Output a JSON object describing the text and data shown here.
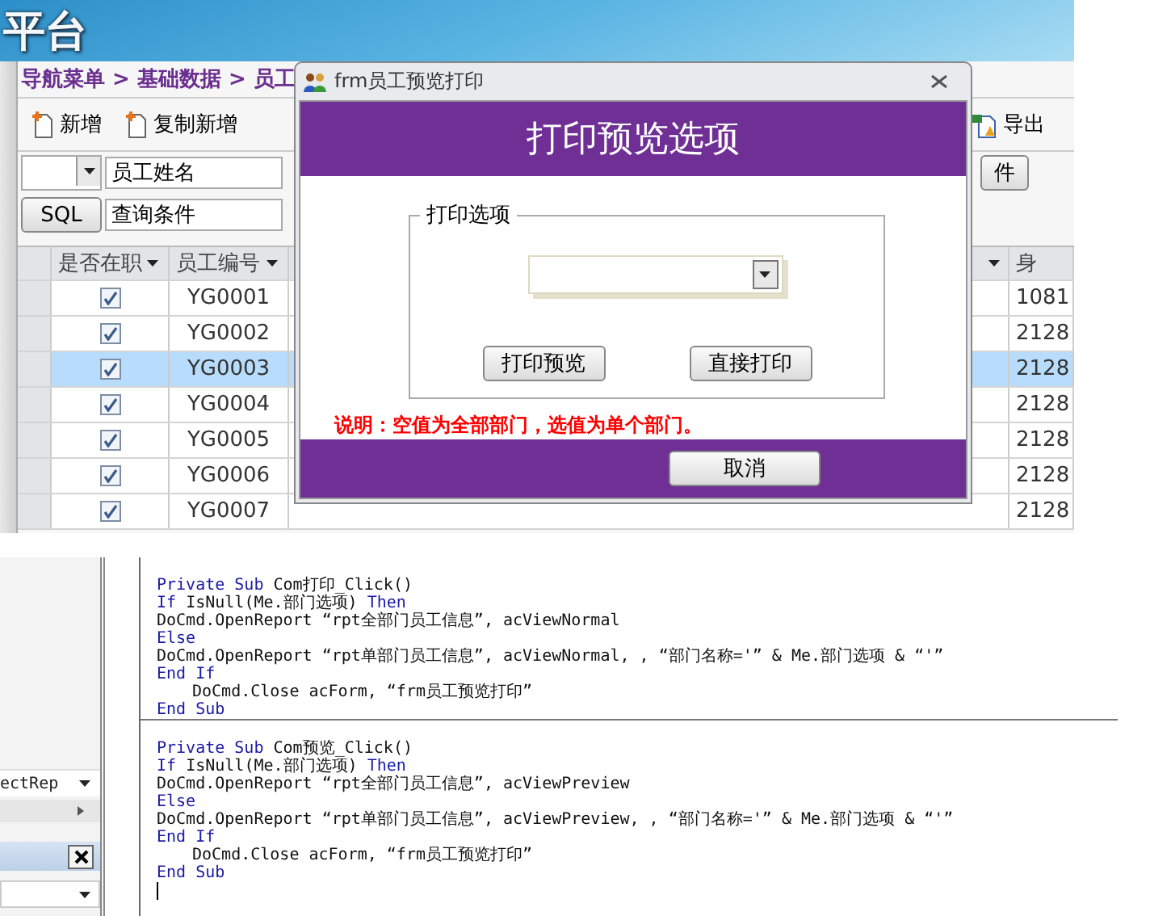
{
  "banner": {
    "title": "平台"
  },
  "breadcrumb": "导航菜单 > 基础数据 > 员工",
  "toolbar": [
    {
      "label": "新增",
      "kind": "new"
    },
    {
      "label": "复制新增",
      "kind": "new"
    },
    {
      "label": "导出",
      "kind": "export"
    }
  ],
  "search": {
    "value": "员工姓名",
    "button": "件"
  },
  "query": {
    "button": "SQL",
    "value": "查询条件"
  },
  "table": {
    "columns": [
      "是否在职",
      "员工编号"
    ],
    "last_column": "身",
    "rows": [
      {
        "active": true,
        "code": "YG0001",
        "column_9": "1081",
        "selected": false
      },
      {
        "active": true,
        "code": "YG0002",
        "column_9": "2128",
        "selected": false
      },
      {
        "active": true,
        "code": "YG0003",
        "column_9": "2128",
        "selected": true
      },
      {
        "active": true,
        "code": "YG0004",
        "column_9": "2128",
        "selected": false
      },
      {
        "active": true,
        "code": "YG0005",
        "column_9": "2128",
        "selected": false
      },
      {
        "active": true,
        "code": "YG0006",
        "column_9": "2128",
        "selected": false
      },
      {
        "active": true,
        "code": "YG0007",
        "column_9": "2128",
        "selected": false
      }
    ]
  },
  "dialog": {
    "title": "frm员工预览打印",
    "header": "打印预览选项",
    "group_label": "打印选项",
    "buttons": [
      "打印预览",
      "直接打印"
    ],
    "note": "说明：空值为全部部门，选值为单个部门。",
    "cancel": "取消"
  },
  "left_panel": {
    "property_value": "ectRep"
  },
  "code_blocks": [
    [
      {
        "indent": false,
        "tokens": [
          {
            "kind": "keyword",
            "text": "Private Sub"
          },
          {
            "kind": "plain",
            "text": " Com打印_Click()"
          }
        ]
      },
      {
        "indent": false,
        "tokens": [
          {
            "kind": "keyword",
            "text": "If"
          },
          {
            "kind": "plain",
            "text": " IsNull(Me.部门选项) "
          },
          {
            "kind": "keyword",
            "text": "Then"
          }
        ]
      },
      {
        "indent": false,
        "tokens": [
          {
            "kind": "plain",
            "text": "DoCmd.OpenReport “rpt全部门员工信息”, acViewNormal"
          }
        ]
      },
      {
        "indent": false,
        "tokens": [
          {
            "kind": "keyword",
            "text": "Else"
          }
        ]
      },
      {
        "indent": false,
        "tokens": [
          {
            "kind": "plain",
            "text": "DoCmd.OpenReport “rpt单部门员工信息”, acViewNormal, , “部门名称='” & Me.部门选项 & “'”"
          }
        ]
      },
      {
        "indent": false,
        "tokens": [
          {
            "kind": "keyword",
            "text": "End If"
          }
        ]
      },
      {
        "indent": true,
        "tokens": [
          {
            "kind": "plain",
            "text": "DoCmd.Close acForm, “frm员工预览打印”"
          }
        ]
      },
      {
        "indent": false,
        "tokens": [
          {
            "kind": "keyword",
            "text": "End Sub"
          }
        ]
      }
    ],
    [
      {
        "indent": false,
        "tokens": [
          {
            "kind": "keyword",
            "text": "Private Sub"
          },
          {
            "kind": "plain",
            "text": " Com预览_Click()"
          }
        ]
      },
      {
        "indent": false,
        "tokens": [
          {
            "kind": "keyword",
            "text": "If"
          },
          {
            "kind": "plain",
            "text": " IsNull(Me.部门选项) "
          },
          {
            "kind": "keyword",
            "text": "Then"
          }
        ]
      },
      {
        "indent": false,
        "tokens": [
          {
            "kind": "plain",
            "text": "DoCmd.OpenReport “rpt全部门员工信息”, acViewPreview"
          }
        ]
      },
      {
        "indent": false,
        "tokens": [
          {
            "kind": "keyword",
            "text": "Else"
          }
        ]
      },
      {
        "indent": false,
        "tokens": [
          {
            "kind": "plain",
            "text": "DoCmd.OpenReport “rpt单部门员工信息”, acViewPreview, , “部门名称='” & Me.部门选项 & “'”"
          }
        ]
      },
      {
        "indent": false,
        "tokens": [
          {
            "kind": "keyword",
            "text": "End If"
          }
        ]
      },
      {
        "indent": true,
        "tokens": [
          {
            "kind": "plain",
            "text": "DoCmd.Close acForm, “frm员工预览打印”"
          }
        ]
      },
      {
        "indent": false,
        "tokens": [
          {
            "kind": "keyword",
            "text": "End Sub"
          }
        ]
      }
    ]
  ]
}
